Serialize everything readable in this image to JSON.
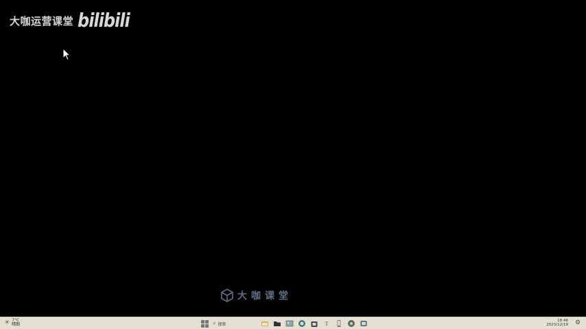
{
  "watermark": {
    "brand_text": "大咖运营课堂",
    "bili_logo": "bilibili"
  },
  "center_watermark": {
    "text": "大咖课堂"
  },
  "taskbar": {
    "weather": {
      "icon": "weather-icon",
      "temperature": "7°C",
      "condition": "晴朗"
    },
    "search": {
      "label": "搜索"
    },
    "icons": [
      "start-icon",
      "search-icon",
      "widgets-icon",
      "folder-icon",
      "photos-icon",
      "edge-icon",
      "store-icon",
      "text-icon",
      "phone-icon",
      "chat-icon",
      "settings-icon"
    ],
    "clock": {
      "time": "18:46",
      "date": "2023/12/19"
    },
    "notification_icon": "notification-icon"
  },
  "colors": {
    "background": "#000000",
    "taskbar": "#e4e0d2",
    "watermark_text": "#e6e6e6",
    "center_watermark": "#5f6f86"
  }
}
